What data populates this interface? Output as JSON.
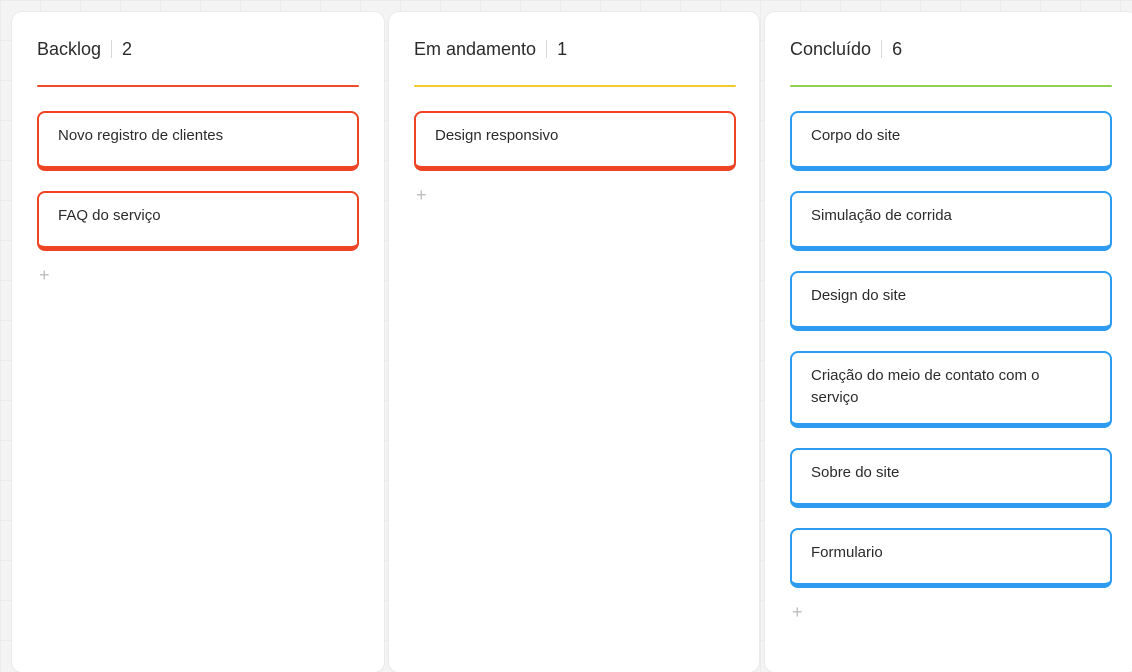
{
  "columns": [
    {
      "title": "Backlog",
      "count": "2",
      "accent": "#ef4b2c",
      "card_color": "#ee4424",
      "add_icon": "plus-icon",
      "add_glyph": "+",
      "cards": [
        "Novo registro de clientes",
        "FAQ do serviço"
      ]
    },
    {
      "title": "Em andamento",
      "count": "1",
      "accent": "#f2cc2b",
      "card_color": "#ee4424",
      "add_icon": "plus-icon",
      "add_glyph": "+",
      "cards": [
        "Design responsivo"
      ]
    },
    {
      "title": "Concluído",
      "count": "6",
      "accent": "#8fd14f",
      "card_color": "#2d9cf0",
      "add_icon": "plus-icon",
      "add_glyph": "+",
      "cards": [
        "Corpo do site",
        "Simulação de corrida",
        "Design do site",
        "Criação do meio de contato com o serviço",
        "Sobre do site",
        "Formulario"
      ]
    }
  ]
}
